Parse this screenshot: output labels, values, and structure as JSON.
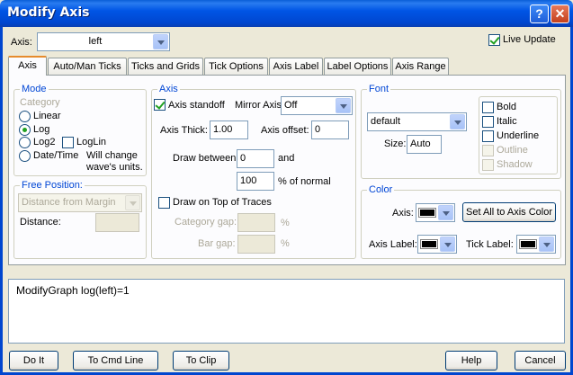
{
  "window": {
    "title": "Modify Axis"
  },
  "top": {
    "axis_label": "Axis:",
    "axis_value": "left",
    "live_update_label": "Live Update",
    "live_update_checked": true
  },
  "tabs": [
    {
      "label": "Axis",
      "active": true
    },
    {
      "label": "Auto/Man Ticks"
    },
    {
      "label": "Ticks and Grids"
    },
    {
      "label": "Tick Options"
    },
    {
      "label": "Axis Label"
    },
    {
      "label": "Label Options"
    },
    {
      "label": "Axis Range"
    }
  ],
  "mode": {
    "title": "Mode",
    "category_label": "Category",
    "options": [
      "Linear",
      "Log",
      "Log2",
      "Date/Time"
    ],
    "selected": "Log",
    "loglin_label": "LogLin",
    "note_line1": "Will change",
    "note_line2": "wave's units."
  },
  "free_position": {
    "title": "Free Position:",
    "value": "Distance from Margin",
    "distance_label": "Distance:",
    "distance_value": ""
  },
  "axis": {
    "title": "Axis",
    "standoff_label": "Axis standoff",
    "standoff_checked": true,
    "mirror_label": "Mirror Axis:",
    "mirror_value": "Off",
    "thick_label": "Axis Thick:",
    "thick_value": "1.00",
    "offset_label": "Axis offset:",
    "offset_value": "0",
    "draw_between_label": "Draw between",
    "draw_from": "0",
    "and_label": "and",
    "draw_to": "100",
    "pct_label": "% of normal",
    "draw_on_top_label": "Draw on Top of Traces",
    "category_gap_label": "Category gap:",
    "bar_gap_label": "Bar gap:",
    "pct_sign": "%"
  },
  "font": {
    "title": "Font",
    "font_value": "default",
    "size_label": "Size:",
    "size_value": "Auto",
    "bold_label": "Bold",
    "italic_label": "Italic",
    "underline_label": "Underline",
    "outline_label": "Outline",
    "shadow_label": "Shadow"
  },
  "color": {
    "title": "Color",
    "axis_label": "Axis:",
    "set_all_label": "Set All to Axis Color",
    "axis_label_label": "Axis Label:",
    "tick_label_label": "Tick Label:",
    "axis_color": "#000000",
    "axis_label_color": "#000000",
    "tick_label_color": "#000000"
  },
  "command": {
    "text": "ModifyGraph log(left)=1"
  },
  "buttons": {
    "do_it": "Do It",
    "to_cmd_line": "To Cmd Line",
    "to_clip": "To Clip",
    "help": "Help",
    "cancel": "Cancel"
  }
}
